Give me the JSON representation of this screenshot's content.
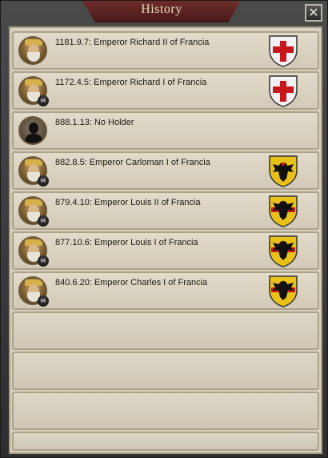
{
  "window": {
    "title": "History",
    "close_glyph": "✕"
  },
  "history": [
    {
      "text": "1181.9.7: Emperor Richard II of Francia",
      "portrait": "emperor-portrait",
      "dead": false,
      "coat": "red-cross",
      "skull": ""
    },
    {
      "text": "1172.4.5: Emperor Richard I of Francia",
      "portrait": "emperor-portrait",
      "dead": true,
      "coat": "red-cross",
      "skull": "☠"
    },
    {
      "text": "888.1.13: No Holder",
      "portrait": "silhouette",
      "dead": false,
      "coat": "none",
      "skull": ""
    },
    {
      "text": "882.8.5: Emperor Carloman I of Francia",
      "portrait": "emperor-portrait",
      "dead": true,
      "coat": "black-eagle",
      "skull": "☠"
    },
    {
      "text": "879.4.10: Emperor Louis II of Francia",
      "portrait": "emperor-portrait",
      "dead": true,
      "coat": "black-eagle",
      "skull": "☠"
    },
    {
      "text": "877.10.6: Emperor Louis I of Francia",
      "portrait": "emperor-portrait",
      "dead": true,
      "coat": "black-eagle",
      "skull": "☠"
    },
    {
      "text": "840.6.20: Emperor Charles I of Francia",
      "portrait": "emperor-portrait",
      "dead": true,
      "coat": "black-eagle",
      "skull": "☠"
    }
  ],
  "colors": {
    "banner": "#5a2220",
    "parchment": "#d9d1bd",
    "shield_red": "#c8161d",
    "shield_gold": "#e8c21a"
  }
}
